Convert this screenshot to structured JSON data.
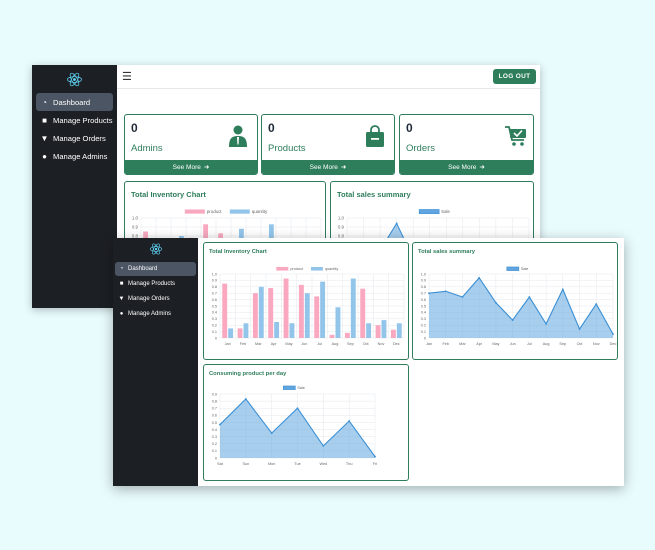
{
  "nav": {
    "items": [
      {
        "label": "Dashboard",
        "icon": "dashboard-icon",
        "active": true
      },
      {
        "label": "Manage Products",
        "icon": "bag-icon",
        "active": false
      },
      {
        "label": "Manage Orders",
        "icon": "cart-icon",
        "active": false
      },
      {
        "label": "Manage Admins",
        "icon": "users-icon",
        "active": false
      }
    ]
  },
  "header": {
    "logout_label": "LOG OUT"
  },
  "stats": [
    {
      "value": "0",
      "label": "Admins",
      "more": "See More",
      "icon": "admin-user-icon"
    },
    {
      "value": "0",
      "label": "Products",
      "more": "See More",
      "icon": "shopping-bag-icon"
    },
    {
      "value": "0",
      "label": "Orders",
      "more": "See More",
      "icon": "cart-check-icon"
    }
  ],
  "colors": {
    "accent": "#2e7d5b",
    "sidebar": "#1c1f24",
    "product": "#f9a8c0",
    "quantity": "#93c5eb",
    "sale": "#60a5e0"
  },
  "chart_data": [
    {
      "type": "bar",
      "title": "Total Inventory Chart",
      "categories": [
        "Jan",
        "Feb",
        "Mar",
        "Apr",
        "May",
        "Jun",
        "Jul",
        "Aug",
        "Sep",
        "Oct",
        "Nov",
        "Dec"
      ],
      "series": [
        {
          "name": "product",
          "values": [
            0.85,
            0.15,
            0.7,
            0.78,
            0.93,
            0.83,
            0.65,
            0.05,
            0.08,
            0.77,
            0.2,
            0.13
          ]
        },
        {
          "name": "quantity",
          "values": [
            0.15,
            0.23,
            0.8,
            0.25,
            0.23,
            0.7,
            0.88,
            0.48,
            0.93,
            0.23,
            0.28,
            0.23
          ]
        }
      ],
      "yticks": [
        "1.0",
        "0.9",
        "0.8",
        "0.7",
        "0.6",
        "0.5",
        "0.4",
        "0.3",
        "0.2",
        "0.1",
        "0"
      ],
      "ylim": [
        0,
        1
      ]
    },
    {
      "type": "area",
      "title": "Total sales summary",
      "categories": [
        "Jan",
        "Feb",
        "Mar",
        "Apr",
        "May",
        "Jun",
        "Jul",
        "Aug",
        "Sep",
        "Oct",
        "Nov",
        "Dec"
      ],
      "series": [
        {
          "name": "Sale",
          "values": [
            0.7,
            0.73,
            0.64,
            0.94,
            0.55,
            0.28,
            0.64,
            0.22,
            0.76,
            0.14,
            0.53,
            0.06
          ]
        }
      ],
      "yticks": [
        "1.0",
        "0.9",
        "0.8",
        "0.7",
        "0.6",
        "0.5",
        "0.4",
        "0.3",
        "0.2",
        "0.1",
        "0"
      ],
      "ylim": [
        0,
        1
      ]
    },
    {
      "type": "area",
      "title": "Consuming product per day",
      "categories": [
        "Sat",
        "Sun",
        "Mon",
        "Tue",
        "Wed",
        "Thu",
        "Fri"
      ],
      "series": [
        {
          "name": "Sale",
          "values": [
            0.47,
            0.83,
            0.35,
            0.7,
            0.17,
            0.52,
            0.02
          ]
        }
      ],
      "yticks": [
        "0.9",
        "0.8",
        "0.7",
        "0.6",
        "0.5",
        "0.4",
        "0.3",
        "0.2",
        "0.1",
        "0"
      ],
      "ylim": [
        0,
        0.9
      ]
    }
  ]
}
